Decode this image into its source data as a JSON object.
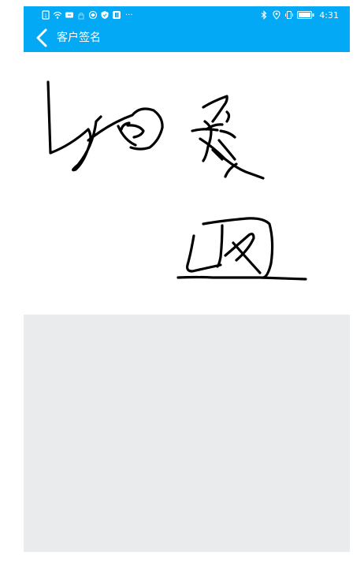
{
  "status_bar": {
    "time": "4:31",
    "overflow": "···",
    "left_icons": [
      "sim-icon",
      "wifi-icon",
      "message-icon",
      "lock-icon",
      "location-icon",
      "shield-icon",
      "app-icon"
    ],
    "right_icons": [
      "bluetooth-icon",
      "location-icon",
      "vibrate-icon",
      "battery-icon"
    ]
  },
  "title_bar": {
    "back_icon": "chevron-left-icon",
    "title": "客户签名",
    "background": "#03a9f4"
  },
  "signature": {
    "ink_color": "#000000",
    "background": "#ffffff"
  },
  "bottom_panel": {
    "background": "#e9ebed"
  }
}
